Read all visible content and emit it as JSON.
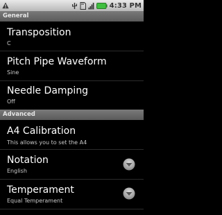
{
  "status_bar": {
    "time": "4:33 PM",
    "icons": [
      "warning-icon",
      "usb-icon",
      "sd-card-icon",
      "signal-icon",
      "battery-icon"
    ]
  },
  "sections": {
    "general": {
      "label": "General"
    },
    "advanced": {
      "label": "Advanced"
    }
  },
  "prefs": {
    "transposition": {
      "title": "Transposition",
      "summary": "C"
    },
    "pitch_pipe": {
      "title": "Pitch Pipe Waveform",
      "summary": "Sine"
    },
    "needle_damping": {
      "title": "Needle Damping",
      "summary": "Off"
    },
    "a4_calibration": {
      "title": "A4 Calibration",
      "summary": "This allows you to set the A4"
    },
    "notation": {
      "title": "Notation",
      "summary": "English"
    },
    "temperament": {
      "title": "Temperament",
      "summary": "Equal Temperament"
    }
  },
  "colors": {
    "background": "#000000",
    "category_bg": "#6a6a6a",
    "summary_text": "#c8c8c8"
  }
}
